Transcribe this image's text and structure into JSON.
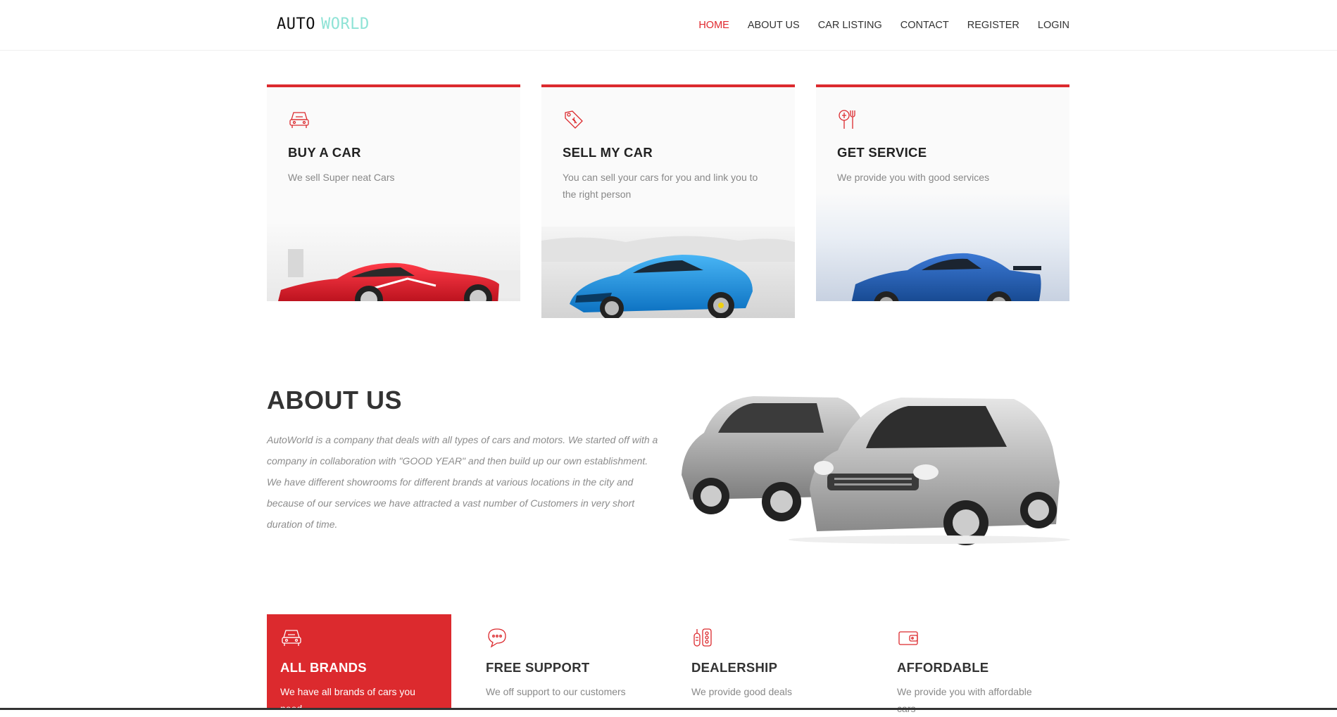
{
  "brand": {
    "part1": "AUTO",
    "part2": "WORLD"
  },
  "nav": {
    "items": [
      {
        "label": "HOME",
        "active": true
      },
      {
        "label": "ABOUT US"
      },
      {
        "label": "CAR LISTING"
      },
      {
        "label": "CONTACT"
      },
      {
        "label": "REGISTER"
      },
      {
        "label": "LOGIN"
      }
    ]
  },
  "services": [
    {
      "icon": "car-icon",
      "title": "BUY A CAR",
      "text": "We sell Super neat Cars",
      "image": "red sports car"
    },
    {
      "icon": "price-tag-icon",
      "title": "SELL MY CAR",
      "text": "You can sell your cars for you and link you to the right person",
      "image": "blue sports car"
    },
    {
      "icon": "tools-icon",
      "title": "GET SERVICE",
      "text": "We provide you with good services",
      "image": "blue coupe"
    }
  ],
  "about": {
    "title": "ABOUT US",
    "text": "AutoWorld is a company that deals with all types of cars and motors. We started off with a company in collaboration with \"GOOD YEAR\" and then build up our own establishment. We have different showrooms for different brands at various locations in the city and because of our services we have attracted a vast number of Customers in very short duration of time."
  },
  "features": [
    {
      "icon": "car-icon",
      "title": "ALL BRANDS",
      "text": "We have all brands of cars you need",
      "active": true
    },
    {
      "icon": "chat-icon",
      "title": "FREE SUPPORT",
      "text": "We off support to our customers"
    },
    {
      "icon": "key-icon",
      "title": "DEALERSHIP",
      "text": "We provide good deals"
    },
    {
      "icon": "wallet-icon",
      "title": "AFFORDABLE",
      "text": "We provide you with affordable cars"
    }
  ],
  "colors": {
    "accent": "#dc2a2e",
    "logo_accent": "#8fe3d6"
  }
}
